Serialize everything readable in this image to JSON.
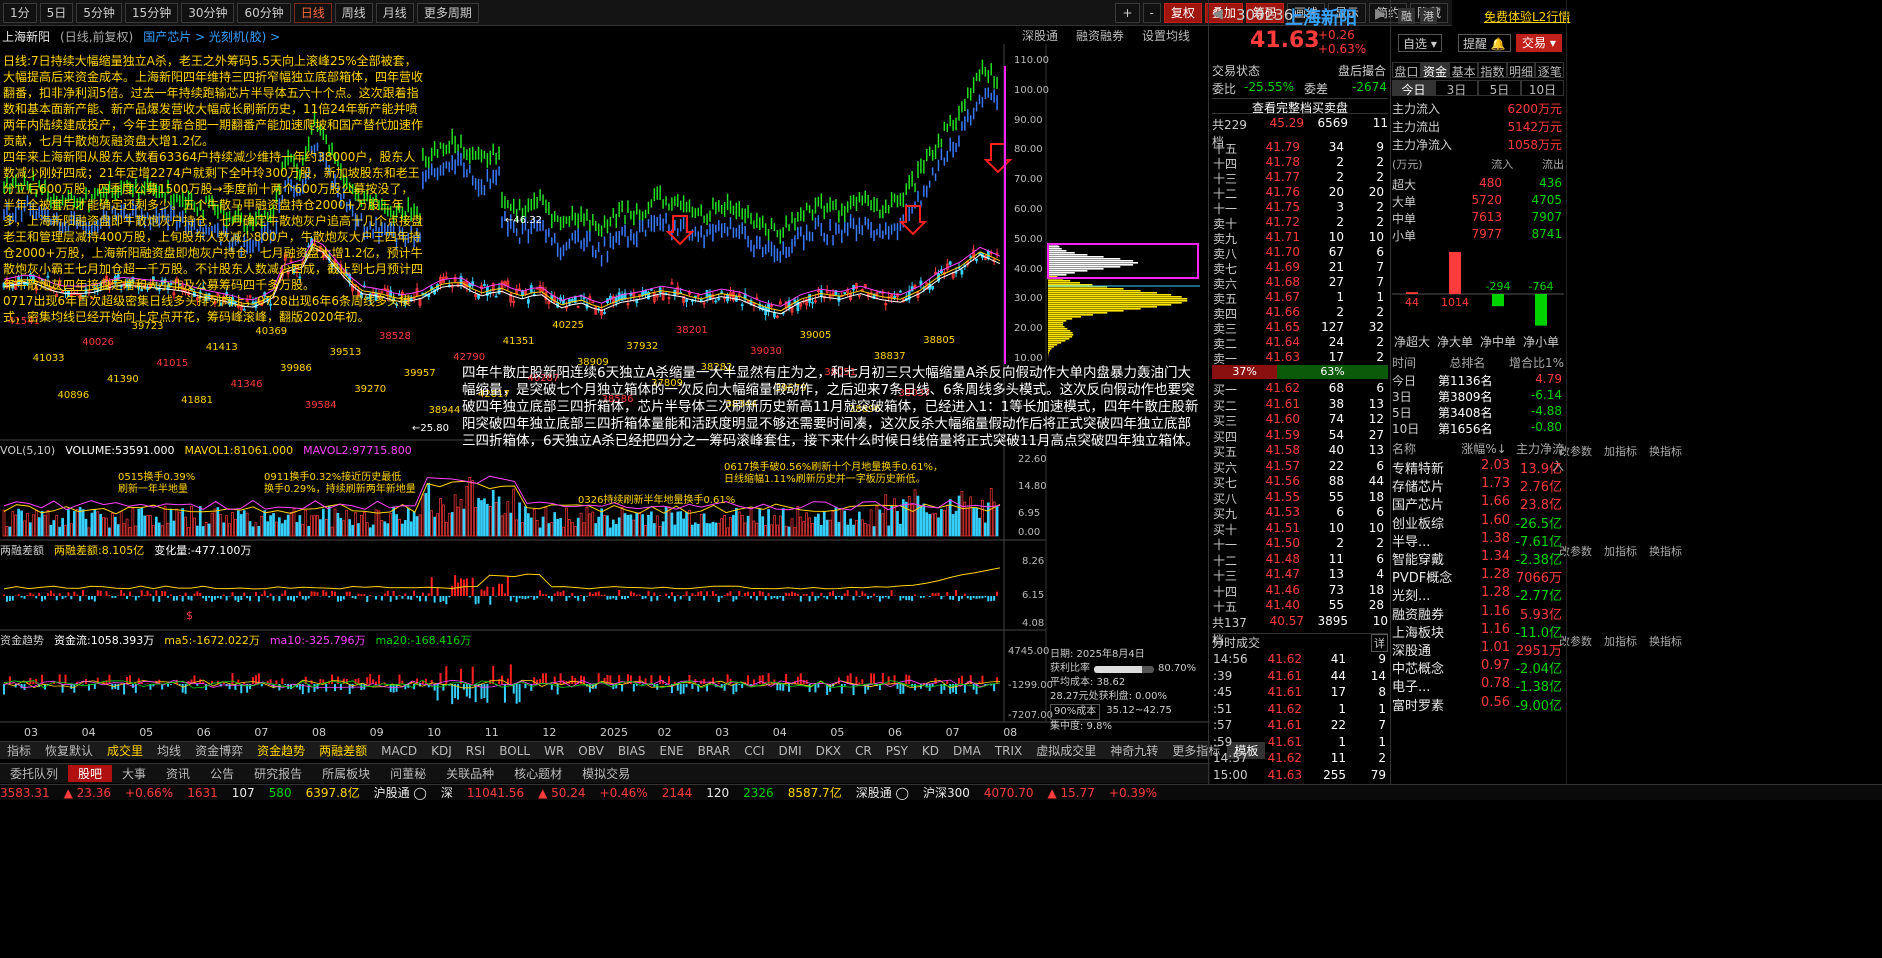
{
  "toolbar": {
    "periods": [
      "1分",
      "5日",
      "5分钟",
      "15分钟",
      "30分钟",
      "60分钟",
      "日线",
      "周线",
      "月线",
      "更多周期"
    ],
    "active_period": "日线",
    "right_buttons": [
      "+",
      "-",
      "复权",
      "叠加",
      "筹码",
      "画线",
      "显示",
      "简约",
      "隐藏"
    ]
  },
  "chart_header": {
    "stock": "上海新阳",
    "mode": "(日线,前复权)",
    "concepts": "国产芯片 > 光刻机(胶) >",
    "right_links": [
      "深股通",
      "融资融券",
      "设置均线"
    ]
  },
  "annotations": {
    "left_text": "日线:7日持续大幅缩量独立A杀，老王之外筹码5.5天向上滚峰25%全部被套，大幅提高后来资金成本。上海新阳四年维持三四折窄幅独立底部箱体，四年营收翻番，扣非净利润5倍。过去一年持续跑输芯片半导体五六十个点。这次跟着指数和基本面新产能、新产品爆发营收大幅成长刷新历史，11倍24年新产能并喷两年内陆续建成投产，今年主要靠合肥一期翻番产能加速爬坡和国产替代加速作贡献，七月牛散炮灰融资盘大增1.2亿。\n四年来上海新阳从股东人数看63364户持续减少维持一年约38000户，股东人数减少刚好四成；21年定增2274户就剩下全叶玲300万股，新加坡股东和老王分立后600万股，四季度公募1500万股→季度前十两个600万股公募按没了，半年全被套后才能确定还剩多少。五个牛散马甲融资盘持仓2000+万股三年多，上海新阳融资盘即牛散炮灰户持仓，七月确定牛散炮灰户追高十几个点接盘老王和管理层减持400万股，上旬股东人数减少800户，牛散炮灰大户三四年持仓2000+万股，上海新阳融资盘即炮灰户持仓，七月融资盘大增1.2亿，预计牛散炮灰小霸王七月加仓超一千万股。不计股东人数减少四成，截止到七月预计四年牛散炮灰四年接盘定增和大小非及公募筹码四千多万股。\n0717出现6年首次超级密集日线多头排列向上，0728出现6年6条周线多头模式，密集均线已经开始向上定点开花，筹码峰滚峰，翻版2020年初。",
    "center_text": "四年牛散庄股新阳连续6天独立A杀缩量一大半显然有庄为之，和七月初三只大幅缩量A杀反向假动作大单内盘暴力轰油门大幅缩量，是突破七个月独立箱体的一次反向大幅缩量假动作，之后迎来7条日线、6条周线多头模式。这次反向假动作也要突破四年独立底部三四折箱体，芯片半导体三次刷新历史新高11月就突破箱体，已经进入1：1等长加速模式，四年牛散庄股新阳突破四年独立底部三四折箱体量能和活跃度明显不够还需要时间凑，这次反杀大幅缩量假动作后将正式突破四年独立底部三四折箱体，6天独立A杀已经把四分之一筹码滚峰套住，接下来什么时候日线倍量将正式突破11月高点突破四年独立箱体。",
    "mark_labels": [
      "46.32",
      "25.80"
    ],
    "price_marks": [
      "41541",
      "41033",
      "40896",
      "40026",
      "41390",
      "39723",
      "41015",
      "41881",
      "41413",
      "41346",
      "40369",
      "39986",
      "39584",
      "39513",
      "39270",
      "38528",
      "39957",
      "38944",
      "42790",
      "42817",
      "41351",
      "40287",
      "40225",
      "38909",
      "38586",
      "37932",
      "37809",
      "38201",
      "38282",
      "38344",
      "39030",
      "39679",
      "39005",
      "38051",
      "38896",
      "38837",
      "38037",
      "38805"
    ]
  },
  "price_axis": [
    "110.00",
    "100.00",
    "90.00",
    "80.00",
    "70.00",
    "60.00",
    "50.00",
    "40.00",
    "30.00",
    "20.00",
    "10.00"
  ],
  "vol_panel": {
    "title": "VOL(5,10)",
    "volume": "VOLUME:53591.000",
    "mavol1": "MAVOL1:81061.000",
    "mavol2": "MAVOL2:97715.800",
    "tools": [
      "改参数",
      "加指标",
      "换指标"
    ],
    "axis": [
      "22.60",
      "14.80",
      "6.95",
      "0.00"
    ],
    "notes": [
      "0515换手0.39%\n刷新一年半地量",
      "0911换手0.32%接近历史最低\n换手0.29%，持续刷新两年新地量",
      "0326持续刷新半年地量换手0.61%",
      "0617换手破0.56%刷新十个月地量换手0.61%，\n日线缩幅1.11%刷新历史并一字板历史新低。"
    ]
  },
  "margin_panel": {
    "name": "两融差额",
    "value": "两融差额:8.105亿",
    "change": "变化量:-477.100万",
    "tools": [
      "改参数",
      "加指标",
      "换指标"
    ],
    "axis": [
      "8.26",
      "6.15",
      "4.08"
    ]
  },
  "fund_panel": {
    "name": "资金趋势",
    "value": "资金流:1058.393万",
    "ma5": "ma5:-1672.022万",
    "ma10": "ma10:-325.796万",
    "ma20": "ma20:-168.416万",
    "tools": [
      "改参数",
      "加指标",
      "换指标"
    ],
    "axis": [
      "4745.00",
      "-1299.00",
      "-7207.00"
    ]
  },
  "x_axis": [
    "03",
    "04",
    "05",
    "06",
    "07",
    "08",
    "09",
    "10",
    "11",
    "12",
    "2025",
    "02",
    "03",
    "04",
    "05",
    "06",
    "07",
    "08"
  ],
  "infobox": {
    "date": "日期: 2025年8月4日",
    "profit_ratio_label": "获利比率",
    "profit_ratio": "80.70%",
    "avg_cost": "平均成本: 38.62",
    "pct_label": "28.27元处获利盘: 0.00%",
    "cost_select": "90%成本",
    "cost_range": "35.12~42.75",
    "concentration": "集中度: 9.8%"
  },
  "indicator_tabs": [
    "指标",
    "恢复默认",
    "成交里",
    "均线",
    "资金博弈",
    "资金趋势",
    "两融差额",
    "MACD",
    "KDJ",
    "RSI",
    "BOLL",
    "WR",
    "OBV",
    "BIAS",
    "ENE",
    "BRAR",
    "CCI",
    "DMI",
    "DKX",
    "CR",
    "PSY",
    "KD",
    "DMA",
    "TRIX",
    "虚拟成交里",
    "神奇九转",
    "更多指标",
    "模板"
  ],
  "nav_tabs": [
    "委托队列",
    "股吧",
    "大事",
    "资讯",
    "公告",
    "研究报告",
    "所属板块",
    "问董秘",
    "关联品种",
    "核心题材",
    "模拟交易"
  ],
  "nav_active": "股吧",
  "status_bar": [
    {
      "text": "3583.31",
      "color": "red"
    },
    {
      "text": "▲ 23.36",
      "color": "red"
    },
    {
      "text": "+0.66%",
      "color": "red"
    },
    {
      "text": "1631",
      "color": "red"
    },
    {
      "text": "107",
      "color": "white"
    },
    {
      "text": "580",
      "color": "green"
    },
    {
      "text": "6397.8亿",
      "color": "yellow"
    },
    {
      "text": "沪股通 ◯",
      "color": "white"
    },
    {
      "text": "深",
      "color": "white"
    },
    {
      "text": "11041.56",
      "color": "red"
    },
    {
      "text": "▲ 50.24",
      "color": "red"
    },
    {
      "text": "+0.46%",
      "color": "red"
    },
    {
      "text": "2144",
      "color": "red"
    },
    {
      "text": "120",
      "color": "white"
    },
    {
      "text": "2326",
      "color": "green"
    },
    {
      "text": "8587.7亿",
      "color": "yellow"
    },
    {
      "text": "深股通 ◯",
      "color": "white"
    },
    {
      "text": "沪深300",
      "color": "white"
    },
    {
      "text": "4070.70",
      "color": "red"
    },
    {
      "text": "▲ 15.77",
      "color": "red"
    },
    {
      "text": "+0.39%",
      "color": "red"
    }
  ],
  "quote": {
    "code": "300236",
    "name": "上海新阳",
    "price": "41.63",
    "change": "+0.26",
    "change_pct": "+0.63%",
    "tags": [
      "融",
      "港"
    ],
    "trial_text": "免费体验L2行情",
    "btn_watch": "自选",
    "btn_alert": "提醒",
    "btn_trade": "交易",
    "trade_state_label": "交易状态",
    "trade_state": "盘后撮合",
    "weibi_label": "委比",
    "weibi": "-25.55%",
    "weicha_label": "委差",
    "weicha": "-2674",
    "full_queue": "查看完整档买卖盘",
    "ask_total_label": "共229档",
    "ask_total_price": "45.29",
    "ask_total_vol": "6569",
    "ask_total_cnt": "11",
    "bid_total_label": "共137档",
    "bid_total_price": "40.57",
    "bid_total_vol": "3895",
    "bid_total_cnt": "10",
    "ratio_left": "37%",
    "ratio_right": "63%"
  },
  "asks": [
    {
      "l": "十五",
      "p": "41.79",
      "v": "34",
      "c": "9"
    },
    {
      "l": "十四",
      "p": "41.78",
      "v": "2",
      "c": "2"
    },
    {
      "l": "十三",
      "p": "41.77",
      "v": "2",
      "c": "2"
    },
    {
      "l": "十二",
      "p": "41.76",
      "v": "20",
      "c": "20"
    },
    {
      "l": "十一",
      "p": "41.75",
      "v": "3",
      "c": "2"
    },
    {
      "l": "卖十",
      "p": "41.72",
      "v": "2",
      "c": "2"
    },
    {
      "l": "卖九",
      "p": "41.71",
      "v": "10",
      "c": "10"
    },
    {
      "l": "卖八",
      "p": "41.70",
      "v": "67",
      "c": "6"
    },
    {
      "l": "卖七",
      "p": "41.69",
      "v": "21",
      "c": "7"
    },
    {
      "l": "卖六",
      "p": "41.68",
      "v": "27",
      "c": "7"
    },
    {
      "l": "卖五",
      "p": "41.67",
      "v": "1",
      "c": "1"
    },
    {
      "l": "卖四",
      "p": "41.66",
      "v": "2",
      "c": "2"
    },
    {
      "l": "卖三",
      "p": "41.65",
      "v": "127",
      "c": "32"
    },
    {
      "l": "卖二",
      "p": "41.64",
      "v": "24",
      "c": "2"
    },
    {
      "l": "卖一",
      "p": "41.63",
      "v": "17",
      "c": "2"
    }
  ],
  "bids": [
    {
      "l": "买一",
      "p": "41.62",
      "v": "68",
      "c": "6"
    },
    {
      "l": "买二",
      "p": "41.61",
      "v": "38",
      "c": "13"
    },
    {
      "l": "买三",
      "p": "41.60",
      "v": "74",
      "c": "12"
    },
    {
      "l": "买四",
      "p": "41.59",
      "v": "54",
      "c": "27"
    },
    {
      "l": "买五",
      "p": "41.58",
      "v": "40",
      "c": "13"
    },
    {
      "l": "买六",
      "p": "41.57",
      "v": "22",
      "c": "6"
    },
    {
      "l": "买七",
      "p": "41.56",
      "v": "88",
      "c": "44"
    },
    {
      "l": "买八",
      "p": "41.55",
      "v": "55",
      "c": "18"
    },
    {
      "l": "买九",
      "p": "41.53",
      "v": "6",
      "c": "6"
    },
    {
      "l": "买十",
      "p": "41.51",
      "v": "10",
      "c": "10"
    },
    {
      "l": "十一",
      "p": "41.50",
      "v": "2",
      "c": "2"
    },
    {
      "l": "十二",
      "p": "41.48",
      "v": "11",
      "c": "6"
    },
    {
      "l": "十三",
      "p": "41.47",
      "v": "13",
      "c": "4"
    },
    {
      "l": "十四",
      "p": "41.46",
      "v": "73",
      "c": "18"
    },
    {
      "l": "十五",
      "p": "41.40",
      "v": "55",
      "c": "28"
    }
  ],
  "ticks_title": "分时成交",
  "ticks_detail": "详",
  "ticks": [
    {
      "t": "14:56",
      "p": "41.62",
      "v": "41",
      "n": "9"
    },
    {
      "t": ":39",
      "p": "41.61",
      "v": "44",
      "n": "14"
    },
    {
      "t": ":45",
      "p": "41.61",
      "v": "17",
      "n": "8"
    },
    {
      "t": ":51",
      "p": "41.62",
      "v": "1",
      "n": "1"
    },
    {
      "t": ":57",
      "p": "41.61",
      "v": "22",
      "n": "7"
    },
    {
      "t": ":59",
      "p": "41.61",
      "v": "1",
      "n": "1"
    },
    {
      "t": "14:57",
      "p": "41.62",
      "v": "11",
      "n": "2"
    },
    {
      "t": "15:00",
      "p": "41.63",
      "v": "255",
      "n": "79"
    }
  ],
  "ff_tabs": [
    "盘口",
    "资金",
    "基本",
    "指数",
    "明细",
    "逐笔"
  ],
  "ff_periods": [
    "今日",
    "3日",
    "5日",
    "10日"
  ],
  "fund_flow": [
    {
      "k": "主力流入",
      "v": "6200万元"
    },
    {
      "k": "主力流出",
      "v": "5142万元"
    },
    {
      "k": "主力净流入",
      "v": "1058万元"
    }
  ],
  "order_size": {
    "unit": "(万元)",
    "in": "流入",
    "out": "流出",
    "rows": [
      {
        "k": "超大",
        "i": "480",
        "o": "436"
      },
      {
        "k": "大单",
        "i": "5720",
        "o": "4705"
      },
      {
        "k": "中单",
        "i": "7613",
        "o": "7907"
      },
      {
        "k": "小单",
        "i": "7977",
        "o": "8741"
      }
    ]
  },
  "net_bars": {
    "values": [
      44,
      1014,
      -294,
      -764
    ],
    "labels": [
      "44",
      "1014",
      "-294",
      "-764"
    ],
    "names": [
      "净超大",
      "净大单",
      "净中单",
      "净小单"
    ]
  },
  "rank": {
    "headers": [
      "时间",
      "总排名",
      "增合比1%"
    ],
    "rows": [
      {
        "t": "今日",
        "r": "第1136名",
        "v": "4.79"
      },
      {
        "t": "3日",
        "r": "第3809名",
        "v": "-6.14"
      },
      {
        "t": "5日",
        "r": "第3408名",
        "v": "-4.88"
      },
      {
        "t": "10日",
        "r": "第1656名",
        "v": "-0.80"
      }
    ]
  },
  "sectors": {
    "headers": [
      "名称",
      "涨幅%↓",
      "主力净流入"
    ],
    "rows": [
      {
        "n": "专精特新",
        "p": "2.03",
        "f": "13.9亿"
      },
      {
        "n": "存储芯片",
        "p": "1.73",
        "f": "2.76亿"
      },
      {
        "n": "国产芯片",
        "p": "1.66",
        "f": "23.8亿"
      },
      {
        "n": "创业板综",
        "p": "1.60",
        "f": "-26.5亿"
      },
      {
        "n": "半导...",
        "p": "1.38",
        "f": "-7.61亿"
      },
      {
        "n": "智能穿戴",
        "p": "1.34",
        "f": "-2.38亿"
      },
      {
        "n": "PVDF概念",
        "p": "1.28",
        "f": "7066万"
      },
      {
        "n": "光刻...",
        "p": "1.28",
        "f": "-2.77亿"
      },
      {
        "n": "融资融券",
        "p": "1.16",
        "f": "5.93亿"
      },
      {
        "n": "上海板块",
        "p": "1.16",
        "f": "-11.0亿"
      },
      {
        "n": "深股通",
        "p": "1.01",
        "f": "2951万"
      },
      {
        "n": "中芯概念",
        "p": "0.97",
        "f": "-2.04亿"
      },
      {
        "n": "电子...",
        "p": "0.78",
        "f": "-1.38亿"
      },
      {
        "n": "富时罗素",
        "p": "0.56",
        "f": "-9.00亿"
      }
    ]
  },
  "colors": {
    "up": "#ff3b3b",
    "down": "#00d200",
    "yellow": "#ffd400",
    "cyan": "#36d0ff",
    "magenta": "#ff44ff"
  }
}
